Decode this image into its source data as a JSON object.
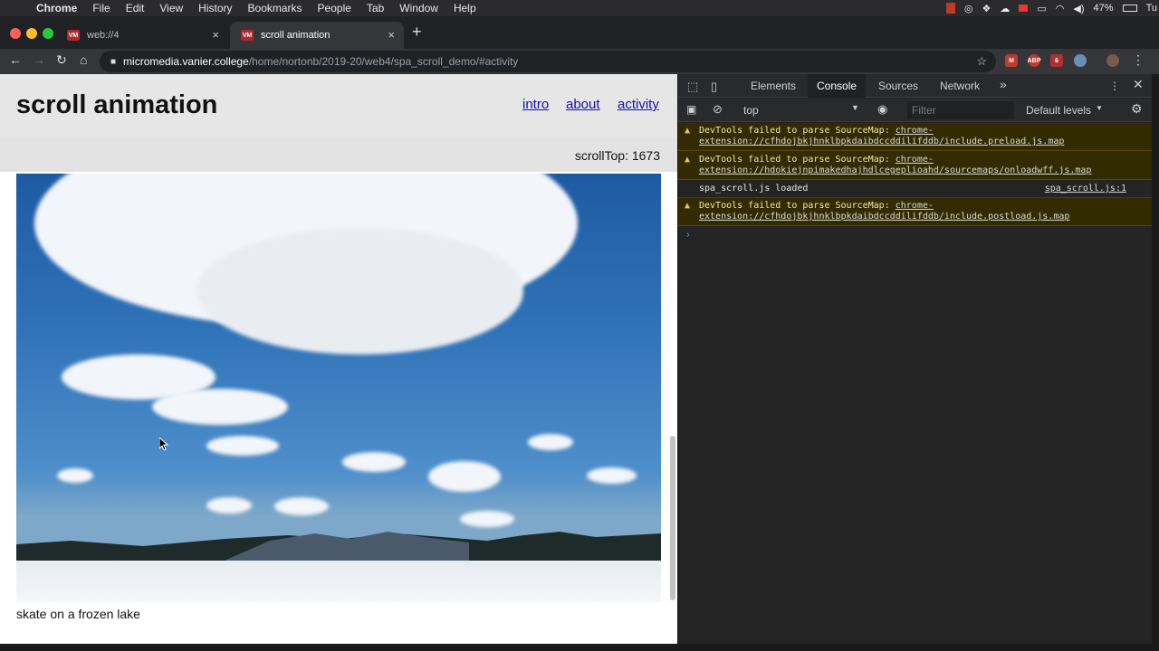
{
  "menubar": {
    "app": "Chrome",
    "items": [
      "File",
      "Edit",
      "View",
      "History",
      "Bookmarks",
      "People",
      "Tab",
      "Window",
      "Help"
    ],
    "battery": "47%",
    "day": "Tu"
  },
  "tabs": [
    {
      "favicon": "VM",
      "title": "web://4",
      "active": false
    },
    {
      "favicon": "VM",
      "title": "scroll animation",
      "active": true
    }
  ],
  "address": {
    "host": "micromedia.vanier.college",
    "path": "/home/nortonb/2019-20/web4/spa_scroll_demo/#activity"
  },
  "extensions": {
    "abp": "ABP",
    "badge": "6"
  },
  "page": {
    "title": "scroll animation",
    "nav": [
      "intro",
      "about",
      "activity"
    ],
    "scroll_top": "scrollTop: 1673",
    "image_caption": "skate on a frozen lake"
  },
  "devtools": {
    "tabs": [
      "Elements",
      "Console",
      "Sources",
      "Network"
    ],
    "more": "»",
    "context": "top",
    "filter_placeholder": "Filter",
    "levels": "Default levels",
    "messages": [
      {
        "type": "warning",
        "text": "DevTools failed to parse SourceMap: ",
        "link": "chrome-extension://cfhdojbkjhnklbpkdaibdccddilifddb/include.preload.js.map"
      },
      {
        "type": "warning",
        "text": "DevTools failed to parse SourceMap: ",
        "link": "chrome-extension://hdokiejnpimakedhajhdlcegeplioahd/sourcemaps/onloadwff.js.map"
      },
      {
        "type": "log",
        "text": "spa_scroll.js loaded",
        "source": "spa_scroll.js:1"
      },
      {
        "type": "warning",
        "text": "DevTools failed to parse SourceMap: ",
        "link": "chrome-extension://cfhdojbkjhnklbpkdaibdccddilifddb/include.postload.js.map"
      }
    ],
    "prompt": "›"
  }
}
